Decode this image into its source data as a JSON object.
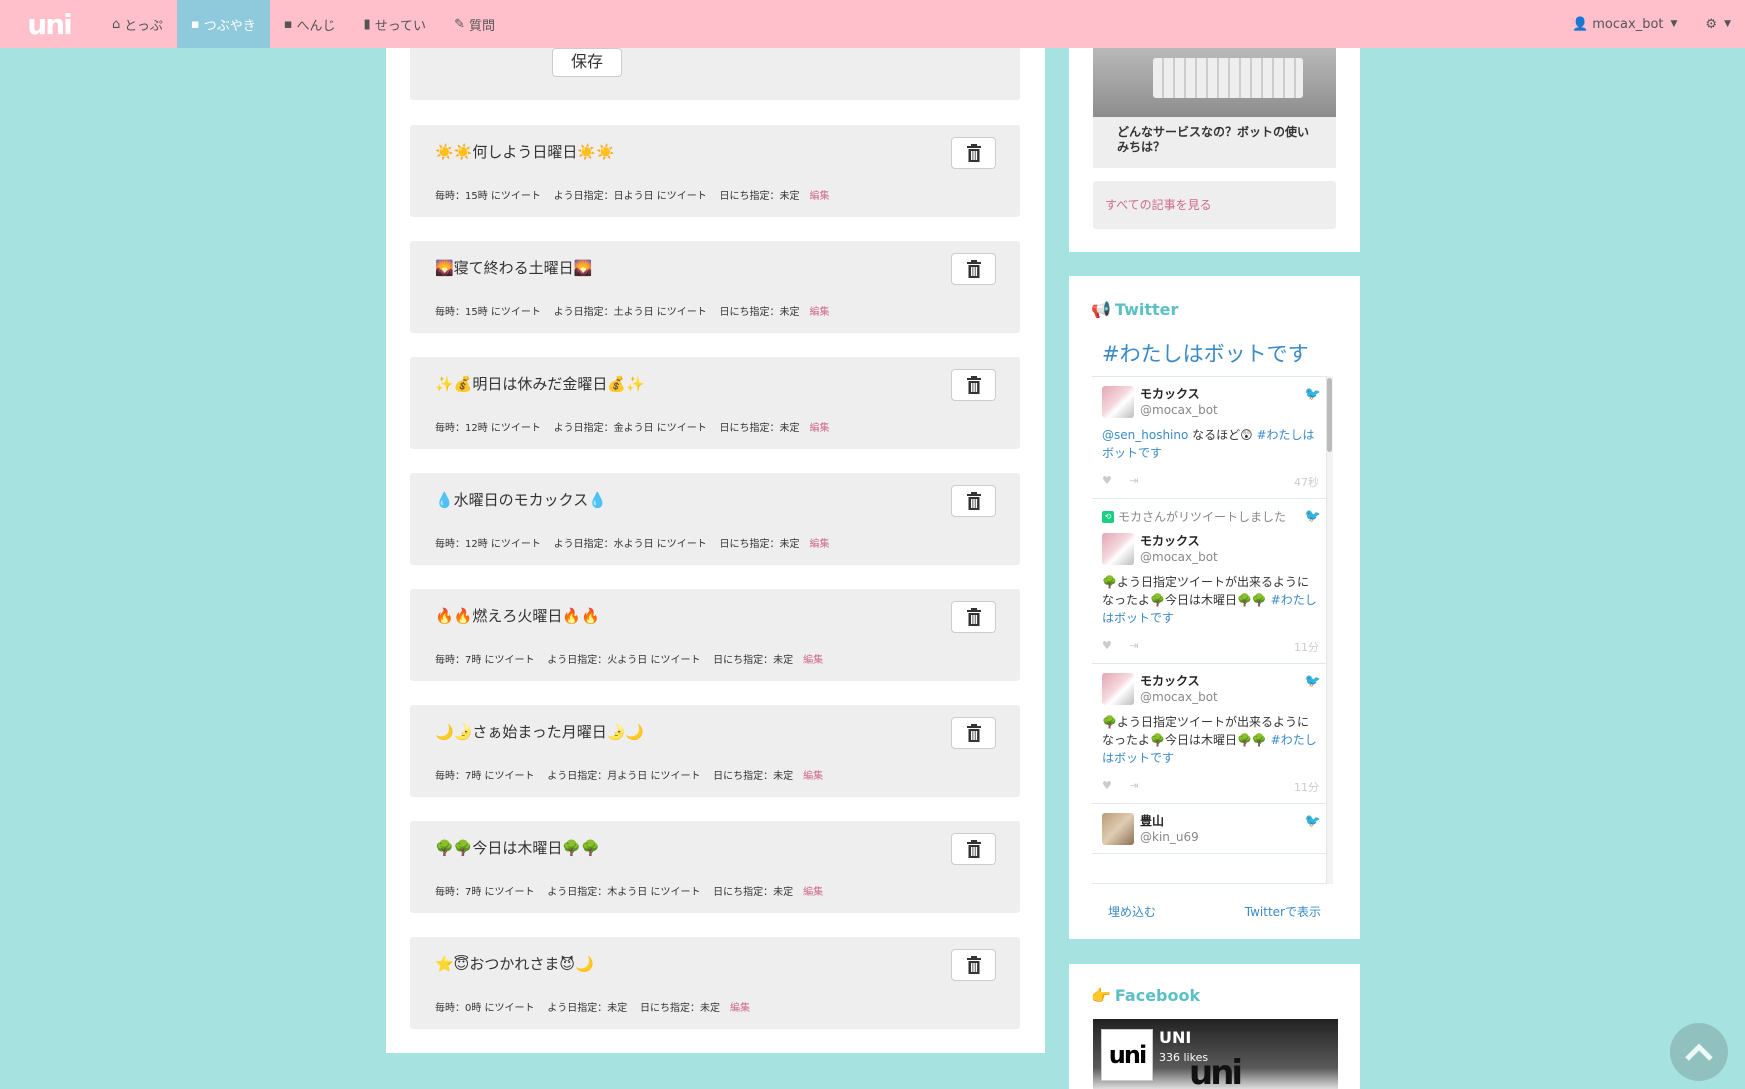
{
  "navbar": {
    "logo": "uni",
    "items": [
      {
        "icon": "home-icon",
        "label": "とっぷ",
        "active": false
      },
      {
        "icon": "comment-icon",
        "label": "つぶやき",
        "active": true
      },
      {
        "icon": "comment-icon",
        "label": "へんじ",
        "active": false
      },
      {
        "icon": "book-icon",
        "label": "せってい",
        "active": false
      },
      {
        "icon": "pencil-icon",
        "label": "質問",
        "active": false
      }
    ],
    "user": "mocax_bot"
  },
  "save_button": "保存",
  "scheduled_tweets": [
    {
      "title": "☀️☀️何しよう日曜日☀️☀️",
      "hour": "毎時：15時 にツイート",
      "weekday": "よう日指定：日よう日 にツイート",
      "day": "日にち指定：未定",
      "edit": "編集"
    },
    {
      "title": "🌄寝て終わる土曜日🌄",
      "hour": "毎時：15時 にツイート",
      "weekday": "よう日指定：土よう日 にツイート",
      "day": "日にち指定：未定",
      "edit": "編集"
    },
    {
      "title": "✨💰明日は休みだ金曜日💰✨",
      "hour": "毎時：12時 にツイート",
      "weekday": "よう日指定：金よう日 にツイート",
      "day": "日にち指定：未定",
      "edit": "編集"
    },
    {
      "title": "💧水曜日のモカックス💧",
      "hour": "毎時：12時 にツイート",
      "weekday": "よう日指定：水よう日 にツイート",
      "day": "日にち指定：未定",
      "edit": "編集"
    },
    {
      "title": "🔥🔥燃えろ火曜日🔥🔥",
      "hour": "毎時：7時 にツイート",
      "weekday": "よう日指定：火よう日 にツイート",
      "day": "日にち指定：未定",
      "edit": "編集"
    },
    {
      "title": "🌙🌛さぁ始まった月曜日🌛🌙",
      "hour": "毎時：7時 にツイート",
      "weekday": "よう日指定：月よう日 にツイート",
      "day": "日にち指定：未定",
      "edit": "編集"
    },
    {
      "title": "🌳🌳今日は木曜日🌳🌳",
      "hour": "毎時：7時 にツイート",
      "weekday": "よう日指定：木よう日 にツイート",
      "day": "日にち指定：未定",
      "edit": "編集"
    },
    {
      "title": "⭐😇おつかれさま😈🌙",
      "hour": "毎時：0時 にツイート",
      "weekday": "よう日指定：未定",
      "day": "日にち指定：未定",
      "edit": "編集"
    }
  ],
  "blog": {
    "caption": "どんなサービスなの？ボットの使いみちは？",
    "all_posts": "すべての記事を見る"
  },
  "twitter": {
    "heading": "Twitter",
    "hashtag": "#わたしはボットです",
    "tweets": [
      {
        "retweet_note": "",
        "name": "モカックス",
        "handle": "@mocax_bot",
        "mention": "@sen_hoshino",
        "text": " なるほど😲 ",
        "tag": "#わたしはボットです",
        "time": "47秒"
      },
      {
        "retweet_note": "モカさんがリツイートしました",
        "name": "モカックス",
        "handle": "@mocax_bot",
        "mention": "",
        "text": "🌳よう日指定ツイートが出来るようになったよ🌳今日は木曜日🌳🌳 ",
        "tag": "#わたしはボットです",
        "time": "11分"
      },
      {
        "retweet_note": "",
        "name": "モカックス",
        "handle": "@mocax_bot",
        "mention": "",
        "text": "🌳よう日指定ツイートが出来るようになったよ🌳今日は木曜日🌳🌳 ",
        "tag": "#わたしはボットです",
        "time": "11分"
      },
      {
        "retweet_note": "",
        "name": "豊山",
        "handle": "@kin_u69",
        "mention": "",
        "text": "",
        "tag": "",
        "time": ""
      }
    ],
    "embed_link": "埋め込む",
    "view_link": "Twitterで表示"
  },
  "facebook": {
    "heading": "Facebook",
    "page_name": "UNI",
    "likes": "336 likes",
    "logo": "uni"
  },
  "colors": {
    "background": "#a6e3e0",
    "navbar": "#ffc0cb",
    "active_tab": "#8fc9dc",
    "edit_link": "#d06a8f",
    "link_blue": "#3a8ac7"
  }
}
